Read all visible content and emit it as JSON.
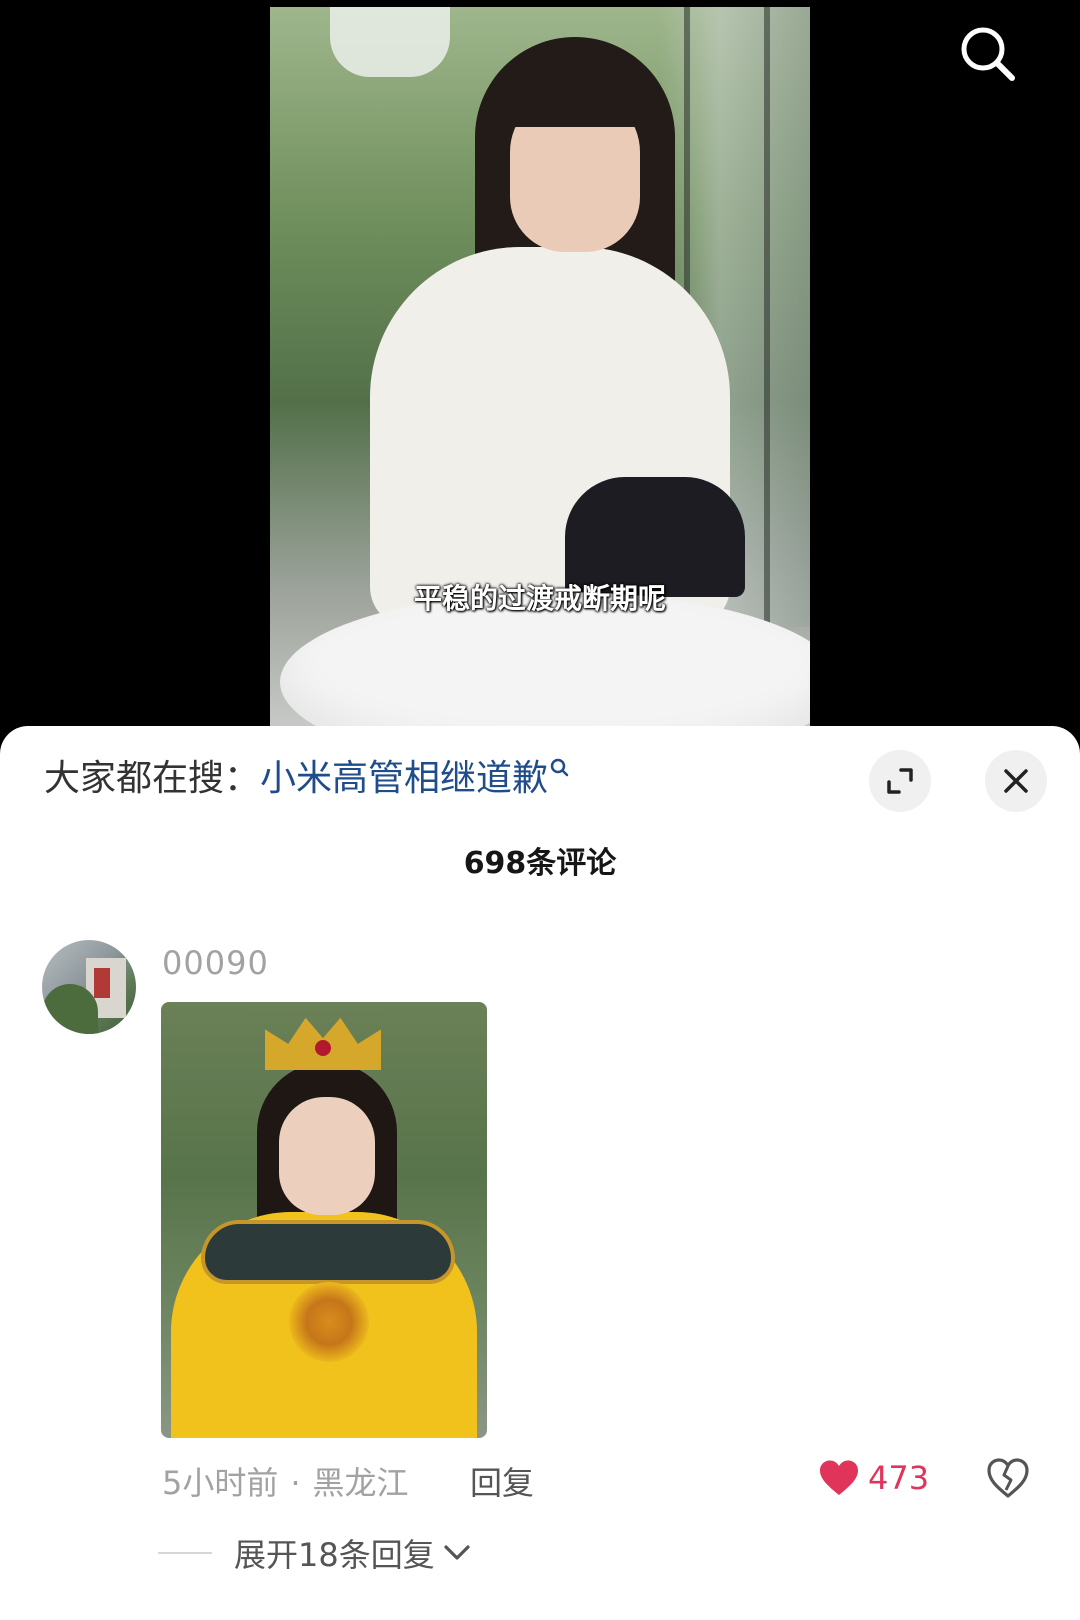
{
  "video": {
    "subtitle": "平稳的过渡戒断期呢",
    "search_icon": "search-icon"
  },
  "sheet": {
    "hot_search_prefix": "大家都在搜：",
    "hot_search_term": "小米高管相继道歉",
    "expand_icon": "expand-icon",
    "close_icon": "close-icon",
    "comment_count": "698条评论"
  },
  "comment": {
    "username": "00090",
    "avatar": "avatar",
    "image": "comment-image",
    "time": "5小时前",
    "location": "黑龙江",
    "separator": "·",
    "reply_label": "回复",
    "like_count": "473",
    "like_icon": "heart-icon",
    "dislike_icon": "broken-heart-icon",
    "expand_replies_label": "展开18条回复"
  },
  "colors": {
    "link_blue": "#1f4c8a",
    "like_red": "#e0345a",
    "muted_gray": "#a2a2a2"
  }
}
